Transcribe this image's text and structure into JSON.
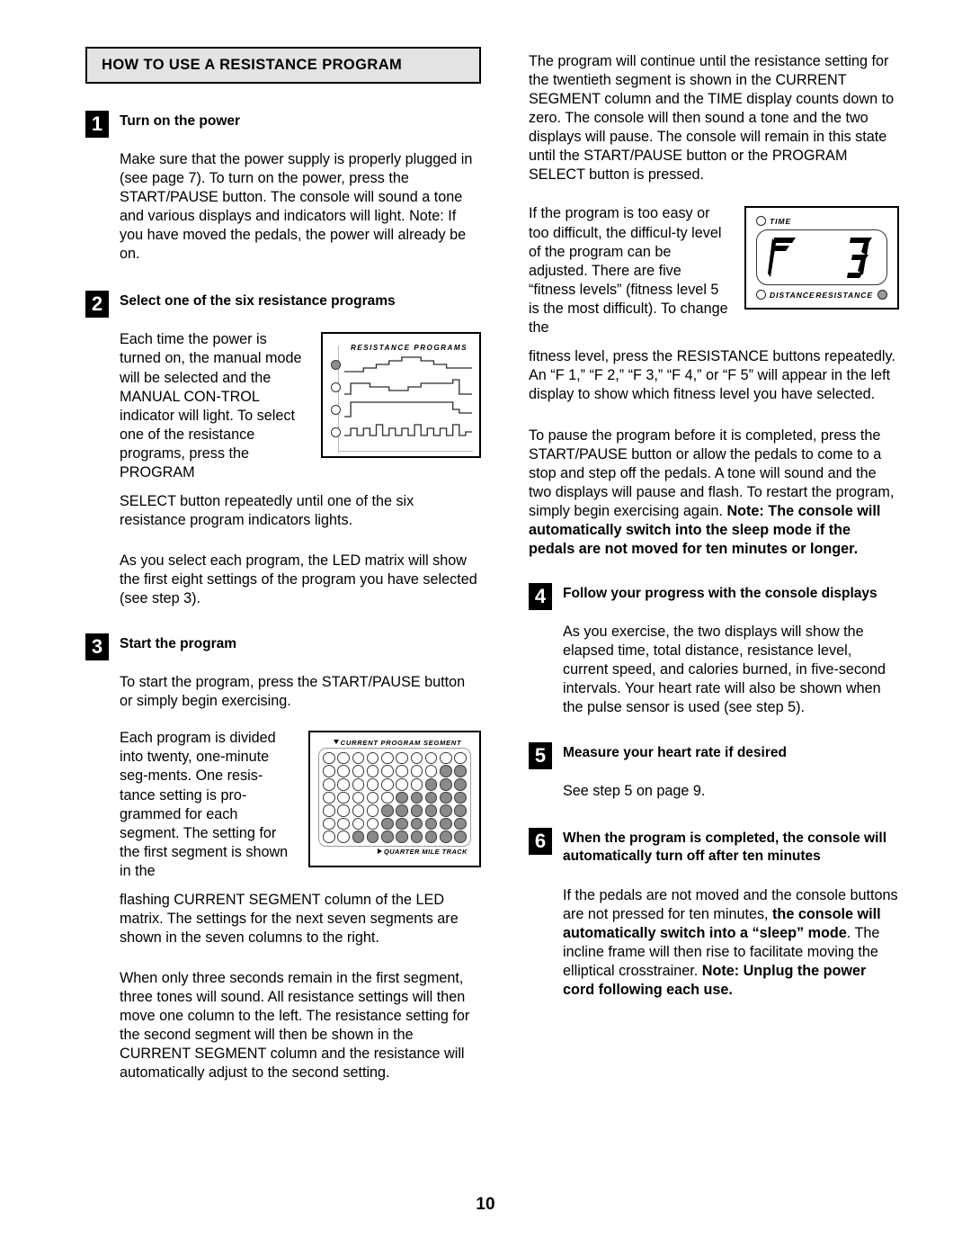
{
  "page": {
    "number": "10"
  },
  "banner": {
    "title": "HOW TO USE A RESISTANCE PROGRAM"
  },
  "left_column": {
    "step1": {
      "number": "1",
      "title": "Turn on the power",
      "paragraph": "Make sure that the power supply is properly plugged in (see page 7). To turn on the power, press the START/PAUSE button. The console will sound a tone and various displays and indicators will light. Note: If you have moved the pedals, the power will already be on."
    },
    "step2": {
      "number": "2",
      "title": "Select one of the six resistance programs",
      "paragraph_wrap": "Each time the power is turned on, the manual mode will be selected and the MANUAL CON-TROL indicator will light. To select one of the resistance programs, press the PROGRAM",
      "paragraph_after": "SELECT button repeatedly until one of the six resistance program indicators lights.",
      "paragraph_2": "As you select each program, the LED matrix will show the first eight settings of the program you have selected (see step 3)."
    },
    "step3": {
      "number": "3",
      "title": "Start the program",
      "paragraph_1": "To start the program, press the START/PAUSE button or simply begin exercising.",
      "paragraph_wrap": "Each program is divided into twenty, one-minute seg-ments. One resis-tance setting is pro-grammed for each segment. The setting for the first segment is shown in the",
      "paragraph_after": "flashing CURRENT SEGMENT column of the LED matrix. The settings for the next seven segments are shown in the seven columns to the right.",
      "paragraph_3": "When only three seconds remain in the first segment, three tones will sound. All resistance settings will then move one column to the left. The resistance setting for the second segment will then be shown in the CURRENT SEGMENT column and the resistance will automatically adjust to the second setting."
    }
  },
  "right_column": {
    "paragraph_1": "The program will continue until the resistance setting for the twentieth segment is shown in the CURRENT SEGMENT column and the TIME display counts down to zero. The console will then sound a tone and the two displays will pause. The console will remain in this state until the START/PAUSE button or the PROGRAM SELECT button is pressed.",
    "paragraph_2_wrap": "If the program is too easy or too difficult, the difficul-ty level of the program can be adjusted. There are five “fitness levels” (fitness level 5 is the most difficult). To change the",
    "paragraph_2_after": "fitness level, press the RESISTANCE buttons repeatedly. An “F 1,” “F 2,” “F 3,” “F 4,” or “F 5” will appear in the left display to show which fitness level you have selected.",
    "paragraph_3_normal": "To pause the program before it is completed, press the START/PAUSE button or allow the pedals to come to a stop and step off the pedals. A tone will sound and the two displays will pause and flash. To restart the program, simply begin exercising again. ",
    "paragraph_3_bold": "Note: The console will automatically switch into the sleep mode if the pedals are not moved for ten minutes or longer.",
    "step4": {
      "number": "4",
      "title": "Follow your progress with the console displays",
      "paragraph": "As you exercise, the two displays will show the elapsed time, total distance, resistance level, current speed, and calories burned, in five-second intervals. Your heart rate will also be shown when the pulse sensor is used (see step 5)."
    },
    "step5": {
      "number": "5",
      "title": "Measure your heart rate if desired",
      "paragraph": "See step 5 on page 9."
    },
    "step6": {
      "number": "6",
      "title": "When the program is completed, the console will automatically turn off after ten minutes",
      "paragraph_part1": "If the pedals are not moved and the console buttons are not pressed for ten minutes, ",
      "paragraph_bold1": "the console will automatically switch into a “sleep” mode",
      "paragraph_part2": ". The incline frame will then rise to facilitate moving the elliptical crosstrainer. ",
      "paragraph_bold2": "Note: Unplug the power cord following each use."
    }
  },
  "figures": {
    "resistance_programs": {
      "title": "RESISTANCE PROGRAMS",
      "indicators": [
        true,
        false,
        false,
        false
      ],
      "program_profiles": [
        {
          "name": "hill",
          "points": [
            0,
            0,
            0,
            1,
            1,
            2,
            2,
            3,
            3,
            4,
            4,
            4,
            3,
            3,
            2,
            2,
            1,
            1,
            1,
            1
          ]
        },
        {
          "name": "rolling",
          "points": [
            0,
            3,
            3,
            3,
            2,
            2,
            2,
            1,
            1,
            1,
            2,
            2,
            3,
            3,
            3,
            3,
            3,
            4,
            0,
            0
          ]
        },
        {
          "name": "plateau",
          "points": [
            0,
            4,
            4,
            4,
            4,
            4,
            4,
            4,
            4,
            4,
            4,
            4,
            4,
            4,
            4,
            4,
            4,
            2,
            1,
            1
          ]
        },
        {
          "name": "interval",
          "points": [
            1,
            3,
            1,
            3,
            1,
            4,
            1,
            3,
            1,
            3,
            1,
            4,
            1,
            3,
            1,
            3,
            1,
            4,
            1,
            2
          ]
        }
      ]
    },
    "led_matrix": {
      "header_label": "CURRENT PROGRAM SEGMENT",
      "footer_label": "QUARTER MILE TRACK",
      "columns": 10,
      "rows": 7,
      "lit_grid": [
        [
          0,
          0,
          0,
          0,
          0,
          0,
          0,
          0,
          0,
          0
        ],
        [
          0,
          0,
          0,
          0,
          0,
          0,
          0,
          0,
          1,
          1
        ],
        [
          0,
          0,
          0,
          0,
          0,
          0,
          0,
          1,
          1,
          1
        ],
        [
          0,
          0,
          0,
          0,
          0,
          1,
          1,
          1,
          1,
          1
        ],
        [
          0,
          0,
          0,
          0,
          1,
          1,
          1,
          1,
          1,
          1
        ],
        [
          0,
          0,
          0,
          0,
          1,
          1,
          1,
          1,
          1,
          1
        ],
        [
          0,
          0,
          1,
          1,
          1,
          1,
          1,
          1,
          1,
          1
        ]
      ]
    },
    "console_display": {
      "label_time": "TIME",
      "label_distance": "DISTANCE",
      "label_resistance": "RESISTANCE",
      "value_left": "F",
      "value_right": "3",
      "indicator_time_on": false,
      "indicator_distance_on": false,
      "indicator_resistance_on": true
    }
  }
}
